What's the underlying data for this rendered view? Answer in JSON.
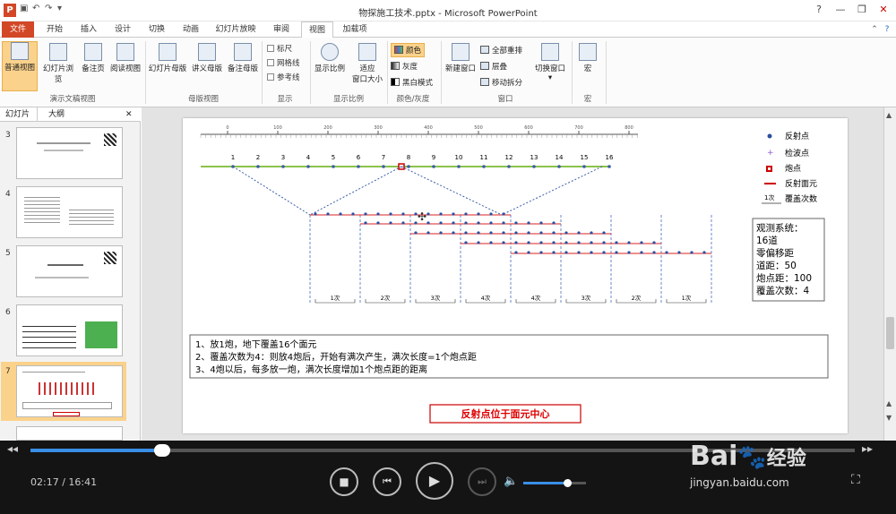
{
  "window": {
    "title": "物探施工技术.pptx - Microsoft PowerPoint"
  },
  "tabs": [
    "文件",
    "开始",
    "插入",
    "设计",
    "切换",
    "动画",
    "幻灯片放映",
    "审阅",
    "视图",
    "加载项"
  ],
  "ribbon": {
    "views": [
      "普通视图",
      "幻灯片浏览",
      "备注页",
      "阅读视图"
    ],
    "group_views": "演示文稿视图",
    "masters": [
      "幻灯片母版",
      "讲义母版",
      "备注母版"
    ],
    "group_masters": "母版视图",
    "show": [
      "标尺",
      "网格线",
      "参考线"
    ],
    "group_show": "显示",
    "zoom": [
      "显示比例",
      "适应\n窗口大小"
    ],
    "group_zoom": "显示比例",
    "color": [
      "颜色",
      "灰度",
      "黑白模式"
    ],
    "group_color": "颜色/灰度",
    "window": [
      "新建窗口",
      "全部重排",
      "层叠",
      "移动拆分",
      "切换窗口"
    ],
    "group_window": "窗口",
    "macro": "宏",
    "group_macro": "宏"
  },
  "panel": {
    "tab_slides": "幻灯片",
    "tab_outline": "大纲",
    "close": "✕"
  },
  "thumbnails": [
    "3",
    "4",
    "5",
    "6",
    "7"
  ],
  "slide": {
    "legend": [
      "反射点",
      "检波点",
      "炮点",
      "反射面元",
      "覆盖次数"
    ],
    "legend_badge": "1次",
    "station_numbers": [
      "1",
      "2",
      "3",
      "4",
      "5",
      "6",
      "7",
      "8",
      "9",
      "10",
      "11",
      "12",
      "13",
      "14",
      "15",
      "16"
    ],
    "coverage_labels": [
      "1次",
      "2次",
      "3次",
      "4次",
      "4次",
      "3次",
      "2次",
      "1次"
    ],
    "ruler_ticks": [
      "0",
      "100",
      "200",
      "300",
      "400",
      "500",
      "600",
      "700",
      "800"
    ],
    "info_lines": [
      "观测系统：",
      "16道",
      "零偏移距",
      "道距：50",
      "炮点距：100",
      "覆盖次数：4"
    ],
    "notes": [
      "1、放1炮，地下覆盖16个面元",
      "2、覆盖次数为4：则放4炮后，开始有满次产生，满次长度=1个炮点距",
      "3、4炮以后，每多放一炮，满次长度增加1个炮点距的距离"
    ],
    "banner": "反射点位于面元中心"
  },
  "player": {
    "current": "02:17",
    "total": "16:41",
    "progress": 0.16,
    "volume": 0.7
  },
  "watermark": {
    "brand": "Bai",
    "brand2": "经验",
    "url": "jingyan.baidu.com"
  }
}
